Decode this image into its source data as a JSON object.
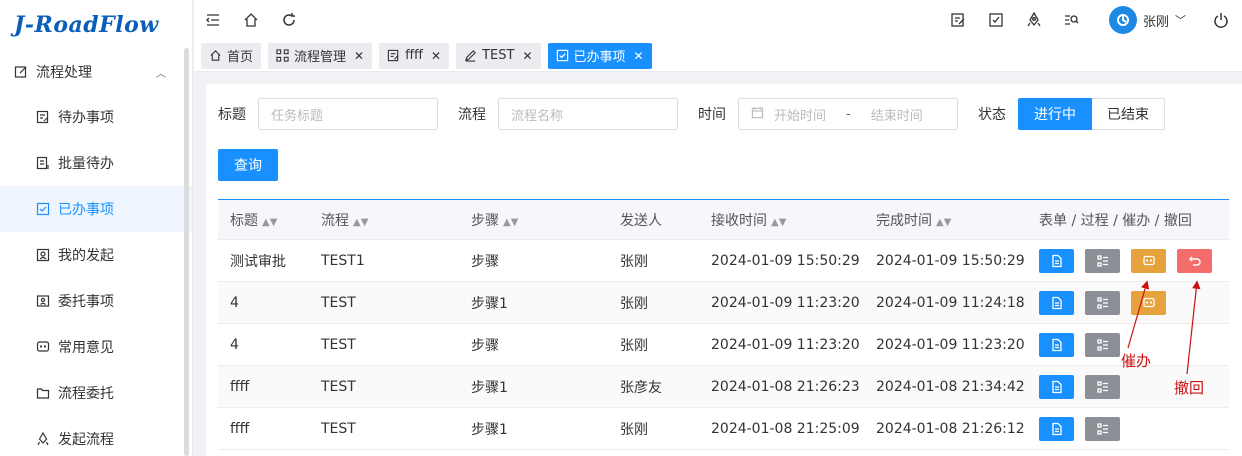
{
  "logo": "J-RoadFlow",
  "sidebar": {
    "group": {
      "label": "流程处理"
    },
    "items": [
      {
        "label": "待办事项",
        "icon": "todo-icon"
      },
      {
        "label": "批量待办",
        "icon": "batch-icon"
      },
      {
        "label": "已办事项",
        "icon": "done-icon",
        "active": true
      },
      {
        "label": "我的发起",
        "icon": "user-icon"
      },
      {
        "label": "委托事项",
        "icon": "delegate-icon"
      },
      {
        "label": "常用意见",
        "icon": "comment-icon"
      },
      {
        "label": "流程委托",
        "icon": "folder-icon"
      },
      {
        "label": "发起流程",
        "icon": "launch-icon"
      }
    ]
  },
  "header": {
    "user_name": "张刚"
  },
  "tabs": [
    {
      "label": "首页",
      "closable": false
    },
    {
      "label": "流程管理",
      "closable": true
    },
    {
      "label": "ffff",
      "closable": true
    },
    {
      "label": "TEST",
      "closable": true
    },
    {
      "label": "已办事项",
      "closable": true,
      "active": true
    }
  ],
  "filter": {
    "title_label": "标题",
    "title_placeholder": "任务标题",
    "flow_label": "流程",
    "flow_placeholder": "流程名称",
    "time_label": "时间",
    "start_placeholder": "开始时间",
    "separator": "-",
    "end_placeholder": "结束时间",
    "status_label": "状态",
    "status_on": "进行中",
    "status_off": "已结束",
    "query_label": "查询"
  },
  "table": {
    "headers": [
      "标题",
      "流程",
      "步骤",
      "发送人",
      "接收时间",
      "完成时间",
      "表单 / 过程 / 催办 / 撤回"
    ],
    "rows": [
      {
        "title": "测试审批",
        "flow": "TEST1",
        "step": "步骤",
        "sender": "张刚",
        "received": "2024-01-09 15:50:29",
        "completed": "2024-01-09 15:50:29",
        "urge": true,
        "withdraw": true
      },
      {
        "title": "4",
        "flow": "TEST",
        "step": "步骤1",
        "sender": "张刚",
        "received": "2024-01-09 11:23:20",
        "completed": "2024-01-09 11:24:18",
        "urge": true,
        "withdraw": false
      },
      {
        "title": "4",
        "flow": "TEST",
        "step": "步骤",
        "sender": "张刚",
        "received": "2024-01-09 11:23:20",
        "completed": "2024-01-09 11:23:20",
        "urge": false,
        "withdraw": false
      },
      {
        "title": "ffff",
        "flow": "TEST",
        "step": "步骤1",
        "sender": "张彦友",
        "received": "2024-01-08 21:26:23",
        "completed": "2024-01-08 21:34:42",
        "urge": false,
        "withdraw": false
      },
      {
        "title": "ffff",
        "flow": "TEST",
        "step": "步骤1",
        "sender": "张刚",
        "received": "2024-01-08 21:25:09",
        "completed": "2024-01-08 21:26:12",
        "urge": false,
        "withdraw": false
      }
    ]
  },
  "annotations": {
    "urge_label": "催办",
    "withdraw_label": "撤回"
  },
  "colors": {
    "primary": "#1890ff",
    "urge": "#e6a23c",
    "withdraw": "#f56c6c",
    "process": "#8c8f95",
    "annotation": "#cc1111"
  }
}
